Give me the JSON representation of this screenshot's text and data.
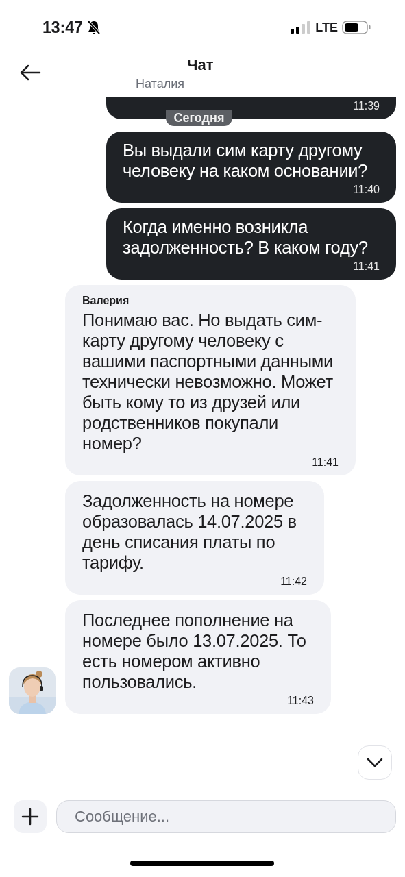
{
  "status_bar": {
    "time": "13:47",
    "network": "LTE"
  },
  "header": {
    "title": "Чат",
    "subtitle": "Наталия"
  },
  "messages": [
    {
      "kind": "outgoing",
      "time": "11:39"
    },
    {
      "kind": "date",
      "text": "Сегодня"
    },
    {
      "kind": "outgoing",
      "text": "Вы выдали сим карту другому человеку на каком основании?",
      "time": "11:40"
    },
    {
      "kind": "outgoing",
      "text": "Когда именно возникла задолженность? В каком году?",
      "time": "11:41"
    },
    {
      "kind": "incoming",
      "author": "Валерия",
      "text": "Понимаю вас. Но выдать сим-карту другому человеку с вашими паспортными данными технически невозможно. Может быть кому то из друзей или родственников покупали номер?",
      "time": "11:41",
      "avatar": false
    },
    {
      "kind": "incoming",
      "text": "Задолженность на номере образовалась 14.07.2025 в день списания платы по тарифу.",
      "time": "11:42",
      "avatar": false
    },
    {
      "kind": "incoming",
      "text": "Последнее пополнение на номере было 13.07.2025. То есть номером активно пользовались.",
      "time": "11:43",
      "avatar": true
    }
  ],
  "composer": {
    "placeholder": "Сообщение..."
  }
}
